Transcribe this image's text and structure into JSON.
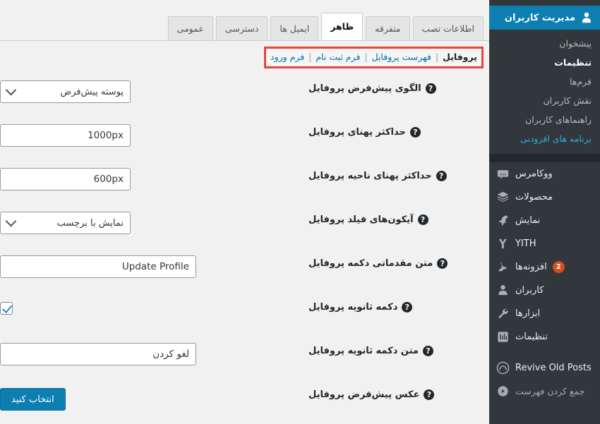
{
  "colors": {
    "accent_blue": "#0c7fb0",
    "sidebar_bg": "#32373c",
    "sidebar_dark": "#23282d",
    "highlight_red": "#e8453c",
    "link_blue": "#0073aa",
    "submenu_accent": "#28b1e0",
    "badge_orange": "#d54e21",
    "content_bg": "#f1f1f1"
  },
  "sidebar": {
    "header": {
      "label": "مدیریت کاربران",
      "icon": "user-icon"
    },
    "submenu": [
      {
        "label": "پیشخوان",
        "state": "normal"
      },
      {
        "label": "تنظیمات",
        "state": "current"
      },
      {
        "label": "فرم‌ها",
        "state": "normal"
      },
      {
        "label": "نقش کاربران",
        "state": "normal"
      },
      {
        "label": "راهنماهای کاربران",
        "state": "normal"
      },
      {
        "label": "برنامه های افزودنی",
        "state": "accent"
      }
    ],
    "menu": [
      {
        "label": "ووکامرس",
        "icon": "woo-icon",
        "badge": ""
      },
      {
        "label": "محصولات",
        "icon": "box-icon",
        "badge": ""
      },
      {
        "label": "نمایش",
        "icon": "pin-icon",
        "badge": ""
      },
      {
        "label": "YITH",
        "icon": "yith-icon",
        "badge": ""
      },
      {
        "label": "افزونه‌ها",
        "icon": "plug-icon",
        "badge": "2"
      },
      {
        "label": "کاربران",
        "icon": "users-icon",
        "badge": ""
      },
      {
        "label": "ابزارها",
        "icon": "wrench-icon",
        "badge": ""
      },
      {
        "label": "تنظیمات",
        "icon": "sliders-icon",
        "badge": ""
      }
    ],
    "extra": [
      {
        "label": "Revive Old Posts",
        "icon": "revive-icon"
      }
    ],
    "collapse": {
      "label": "جمع کردن فهرست",
      "icon": "collapse-icon"
    }
  },
  "tabs": [
    {
      "label": "عمومی",
      "active": false
    },
    {
      "label": "دسترسی",
      "active": false
    },
    {
      "label": "ایمیل ها",
      "active": false
    },
    {
      "label": "ظاهر",
      "active": true
    },
    {
      "label": "متفرقه",
      "active": false
    },
    {
      "label": "اطلاعات تصب",
      "active": false
    }
  ],
  "subtabs": [
    {
      "label": "فرم ورود",
      "current": false
    },
    {
      "label": "فرم ثبت نام",
      "current": false
    },
    {
      "label": "فهرست پروفایل",
      "current": false
    },
    {
      "label": "پروفایل",
      "current": true
    }
  ],
  "subtab_separator": "|",
  "form": {
    "rows": [
      {
        "label": "الگوی پیش‌فرض پروفایل",
        "help": "?",
        "control": "select",
        "value": "پوسته پیش‌فرض"
      },
      {
        "label": "حداکثر پهنای پروفایل",
        "help": "?",
        "control": "input",
        "value": "1000px"
      },
      {
        "label": "حداکثر پهنای ناحیه پروفایل",
        "help": "?",
        "control": "input",
        "value": "600px"
      },
      {
        "label": "آیکون‌های فیلد پروفایل",
        "help": "?",
        "control": "select",
        "value": "نمایش با برچسب"
      },
      {
        "label": "متن مقدماتی دکمه پروفایل",
        "help": "?",
        "control": "input-wide",
        "value": "Update Profile"
      },
      {
        "label": "دکمه ثانویه پروفایل",
        "help": "?",
        "control": "checkbox",
        "value": "checked"
      },
      {
        "label": "متن دکمه ثانویه پروفایل",
        "help": "?",
        "control": "input-wide",
        "value": "لغو کردن"
      },
      {
        "label": "عکس پیش‌فرض پروفایل",
        "help": "?",
        "control": "button",
        "value": "انتخاب کنید"
      }
    ]
  }
}
